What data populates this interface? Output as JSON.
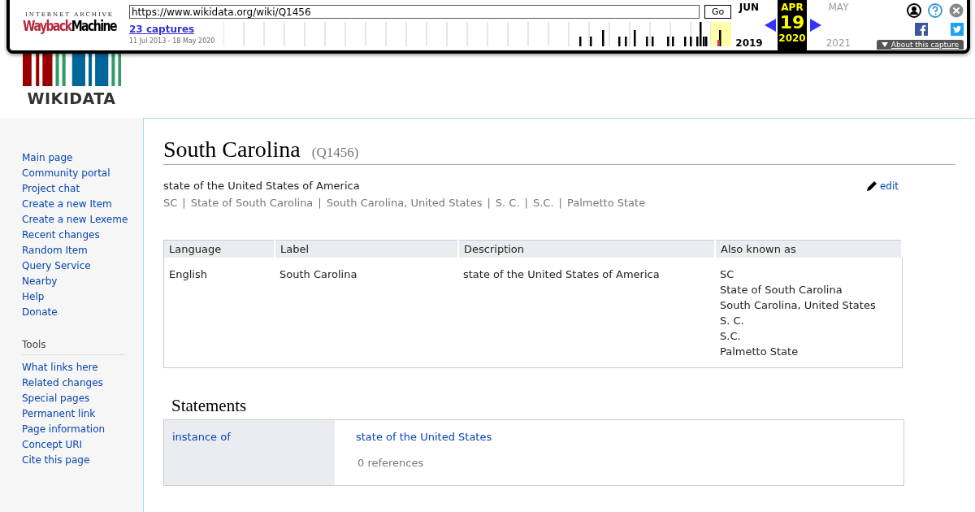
{
  "wayback": {
    "brand_top": "INTERNET ARCHIVE",
    "brand_red": "Wayback",
    "brand_black": "Machine",
    "url": "https://www.wikidata.org/wiki/Q1456",
    "go": "Go",
    "captures": "23 captures",
    "range": "11 Jul 2013 - 18 May 2020",
    "months": [
      {
        "month": "JUN",
        "year": "2019",
        "selected": false,
        "disabled": false
      },
      {
        "month": "APR",
        "day": "19",
        "year": "2020",
        "selected": true,
        "disabled": false
      },
      {
        "month": "MAY",
        "year": "2021",
        "selected": false,
        "disabled": true
      }
    ],
    "about": "About this capture"
  },
  "logo": {
    "text": "WIKIDATA"
  },
  "sidebar": {
    "navigation": [
      "Main page",
      "Community portal",
      "Project chat",
      "Create a new Item",
      "Create a new Lexeme",
      "Recent changes",
      "Random Item",
      "Query Service",
      "Nearby",
      "Help",
      "Donate"
    ],
    "tools_heading": "Tools",
    "tools": [
      "What links here",
      "Related changes",
      "Special pages",
      "Permanent link",
      "Page information",
      "Concept URI",
      "Cite this page"
    ]
  },
  "item": {
    "label": "South Carolina",
    "id": "(Q1456)",
    "description": "state of the United States of America",
    "aliases": [
      "SC",
      "State of South Carolina",
      "South Carolina, United States",
      "S. C.",
      "S.C.",
      "Palmetto State"
    ],
    "separator": "|",
    "edit": "edit"
  },
  "terms_table": {
    "columns": [
      "Language",
      "Label",
      "Description",
      "Also known as"
    ],
    "rows": [
      {
        "language": "English",
        "label": "South Carolina",
        "description": "state of the United States of America",
        "aliases": [
          "SC",
          "State of South Carolina",
          "South Carolina, United States",
          "S. C.",
          "S.C.",
          "Palmetto State"
        ]
      }
    ]
  },
  "statements": {
    "heading": "Statements",
    "groups": [
      {
        "property": "instance of",
        "value": "state of the United States",
        "references": "0 references"
      }
    ]
  }
}
